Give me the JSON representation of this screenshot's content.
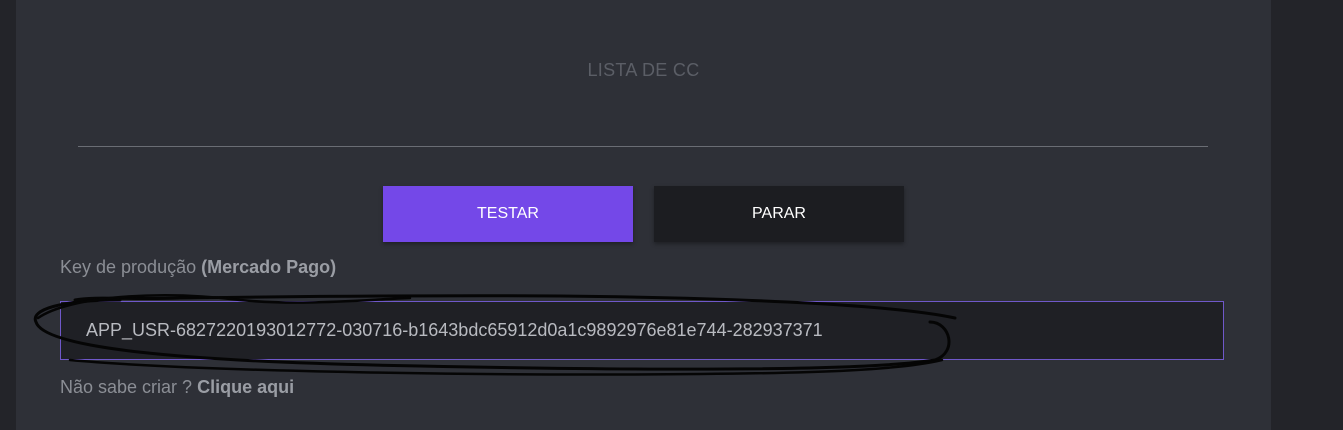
{
  "panel": {
    "list_title": "LISTA DE CC"
  },
  "buttons": {
    "test_label": "TESTAR",
    "stop_label": "PARAR"
  },
  "key_field": {
    "label_prefix": "Key de produção ",
    "label_bold": "(Mercado Pago)",
    "value": "APP_USR-6827220193012772-030716-b1643bdc65912d0a1c9892976e81e744-282937371"
  },
  "help": {
    "prefix": "Não sabe criar ? ",
    "link_text": "Clique aqui"
  },
  "colors": {
    "accent": "#7448e8",
    "background": "#232429",
    "panel": "#2e3037",
    "input_border": "#6f58c9"
  }
}
